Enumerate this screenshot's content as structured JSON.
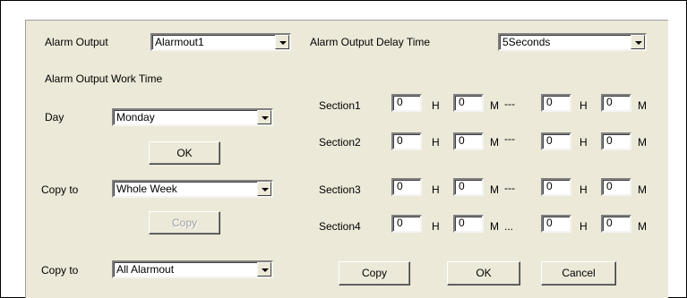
{
  "alarm_output": {
    "label": "Alarm Output",
    "value": "Alarmout1"
  },
  "delay_time": {
    "label": "Alarm Output Delay Time",
    "value": "5Seconds"
  },
  "work_time_label": "Alarm Output Work Time",
  "day": {
    "label": "Day",
    "value": "Monday"
  },
  "ok_label": "OK",
  "copy_to_week": {
    "label": "Copy to",
    "value": "Whole Week"
  },
  "copy_disabled_label": "Copy",
  "copy_to_alarm": {
    "label": "Copy to",
    "value": "All Alarmout"
  },
  "hour_unit": "H",
  "minute_unit": "M",
  "sections": [
    {
      "label": "Section1",
      "start_h": "0",
      "start_m": "0",
      "sep": "---",
      "end_h": "0",
      "end_m": "0"
    },
    {
      "label": "Section2",
      "start_h": "0",
      "start_m": "0",
      "sep": "---",
      "end_h": "0",
      "end_m": "0"
    },
    {
      "label": "Section3",
      "start_h": "0",
      "start_m": "0",
      "sep": "---",
      "end_h": "0",
      "end_m": "0"
    },
    {
      "label": "Section4",
      "start_h": "0",
      "start_m": "0",
      "sep": "...",
      "end_h": "0",
      "end_m": "0"
    }
  ],
  "footer": {
    "copy_label": "Copy",
    "ok_label": "OK",
    "cancel_label": "Cancel"
  }
}
